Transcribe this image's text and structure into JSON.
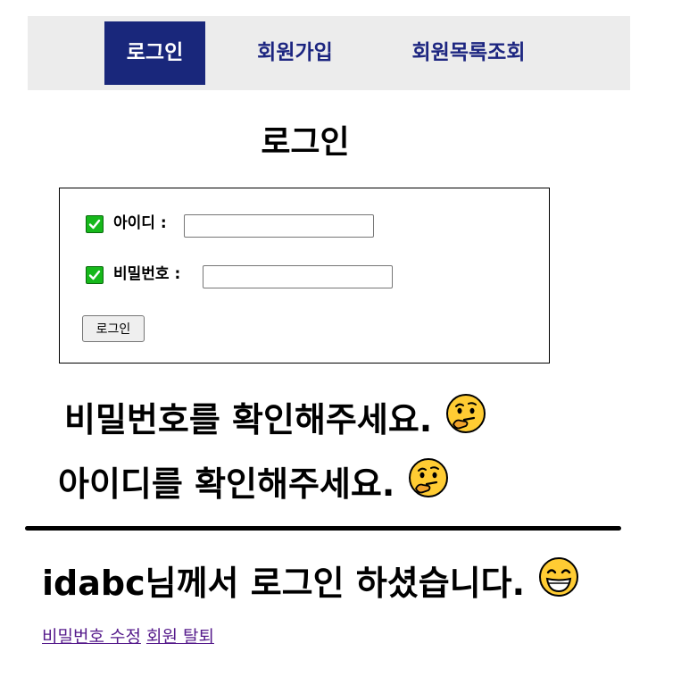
{
  "nav": {
    "items": [
      {
        "label": "로그인",
        "active": true
      },
      {
        "label": "회원가입",
        "active": false
      },
      {
        "label": "회원목록조회",
        "active": false
      }
    ]
  },
  "login": {
    "title": "로그인",
    "id_label": "아이디 :",
    "id_value": "",
    "password_label": "비밀번호 :",
    "password_value": "",
    "submit_label": "로그인",
    "check_icon": "check-mark-button-icon"
  },
  "messages": {
    "password_check": "비밀번호를 확인해주세요.",
    "id_check": "아이디를 확인해주세요.",
    "thinking_icon": "thinking-face-icon",
    "welcome": "idabc님께서 로그인 하셨습니다.",
    "welcome_icon": "grinning-face-icon"
  },
  "links": {
    "change_password": "비밀번호 수정",
    "withdraw": "회원 탈퇴"
  },
  "colors": {
    "nav_bg": "#ececec",
    "nav_active_bg": "#19277b",
    "nav_text": "#1c2580",
    "check_green": "#16b81b",
    "link": "#551a8b"
  }
}
